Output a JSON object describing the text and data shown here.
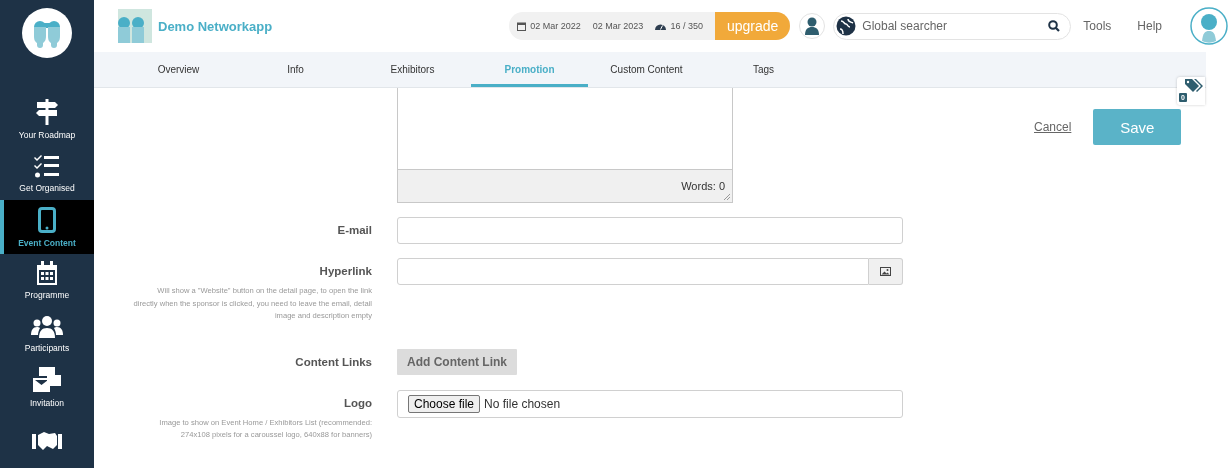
{
  "sidebar": {
    "items": [
      {
        "label": "Your Roadmap",
        "selected": false
      },
      {
        "label": "Get Organised",
        "selected": false
      },
      {
        "label": "Event Content",
        "selected": true
      },
      {
        "label": "Programme",
        "selected": false
      },
      {
        "label": "Participants",
        "selected": false
      },
      {
        "label": "Invitation",
        "selected": false
      },
      {
        "selected": false
      }
    ]
  },
  "header": {
    "app_name": "Demo Networkapp",
    "start_date": "02 Mar 2022",
    "end_date": "02 Mar 2023",
    "usage": "16 / 350",
    "upgrade": "upgrade",
    "search": {
      "placeholder": "Global searcher"
    },
    "links": [
      "Tools",
      "Help"
    ]
  },
  "tabs": [
    {
      "label": "Overview",
      "selected": false
    },
    {
      "label": "Info",
      "selected": false
    },
    {
      "label": "Exhibitors",
      "selected": false
    },
    {
      "label": "Promotion",
      "selected": true
    },
    {
      "label": "Custom Content",
      "selected": false
    },
    {
      "label": "Tags",
      "selected": false
    }
  ],
  "tag_badge": {
    "count": "0"
  },
  "actions": {
    "cancel": "Cancel",
    "save": "Save"
  },
  "editor": {
    "word_count": "Words: 0"
  },
  "form": {
    "rows": [
      {
        "kind": "text",
        "label": "E-mail"
      },
      {
        "kind": "link",
        "label": "Hyperlink",
        "hint": "Will show a \"Website\" button on the detail page, to open the link directly when the sponsor is clicked, you need to leave the email, detail image and description empty"
      },
      {
        "kind": "button",
        "label": "Content Links",
        "button": "Add Content Link"
      },
      {
        "kind": "file",
        "label": "Logo",
        "button": "Choose file",
        "value": "No file chosen",
        "hint": "Image to show on Event Home / Exhibitors List (recommended: 274x108 pixels for a caroussel logo, 640x88 for banners)"
      }
    ]
  }
}
